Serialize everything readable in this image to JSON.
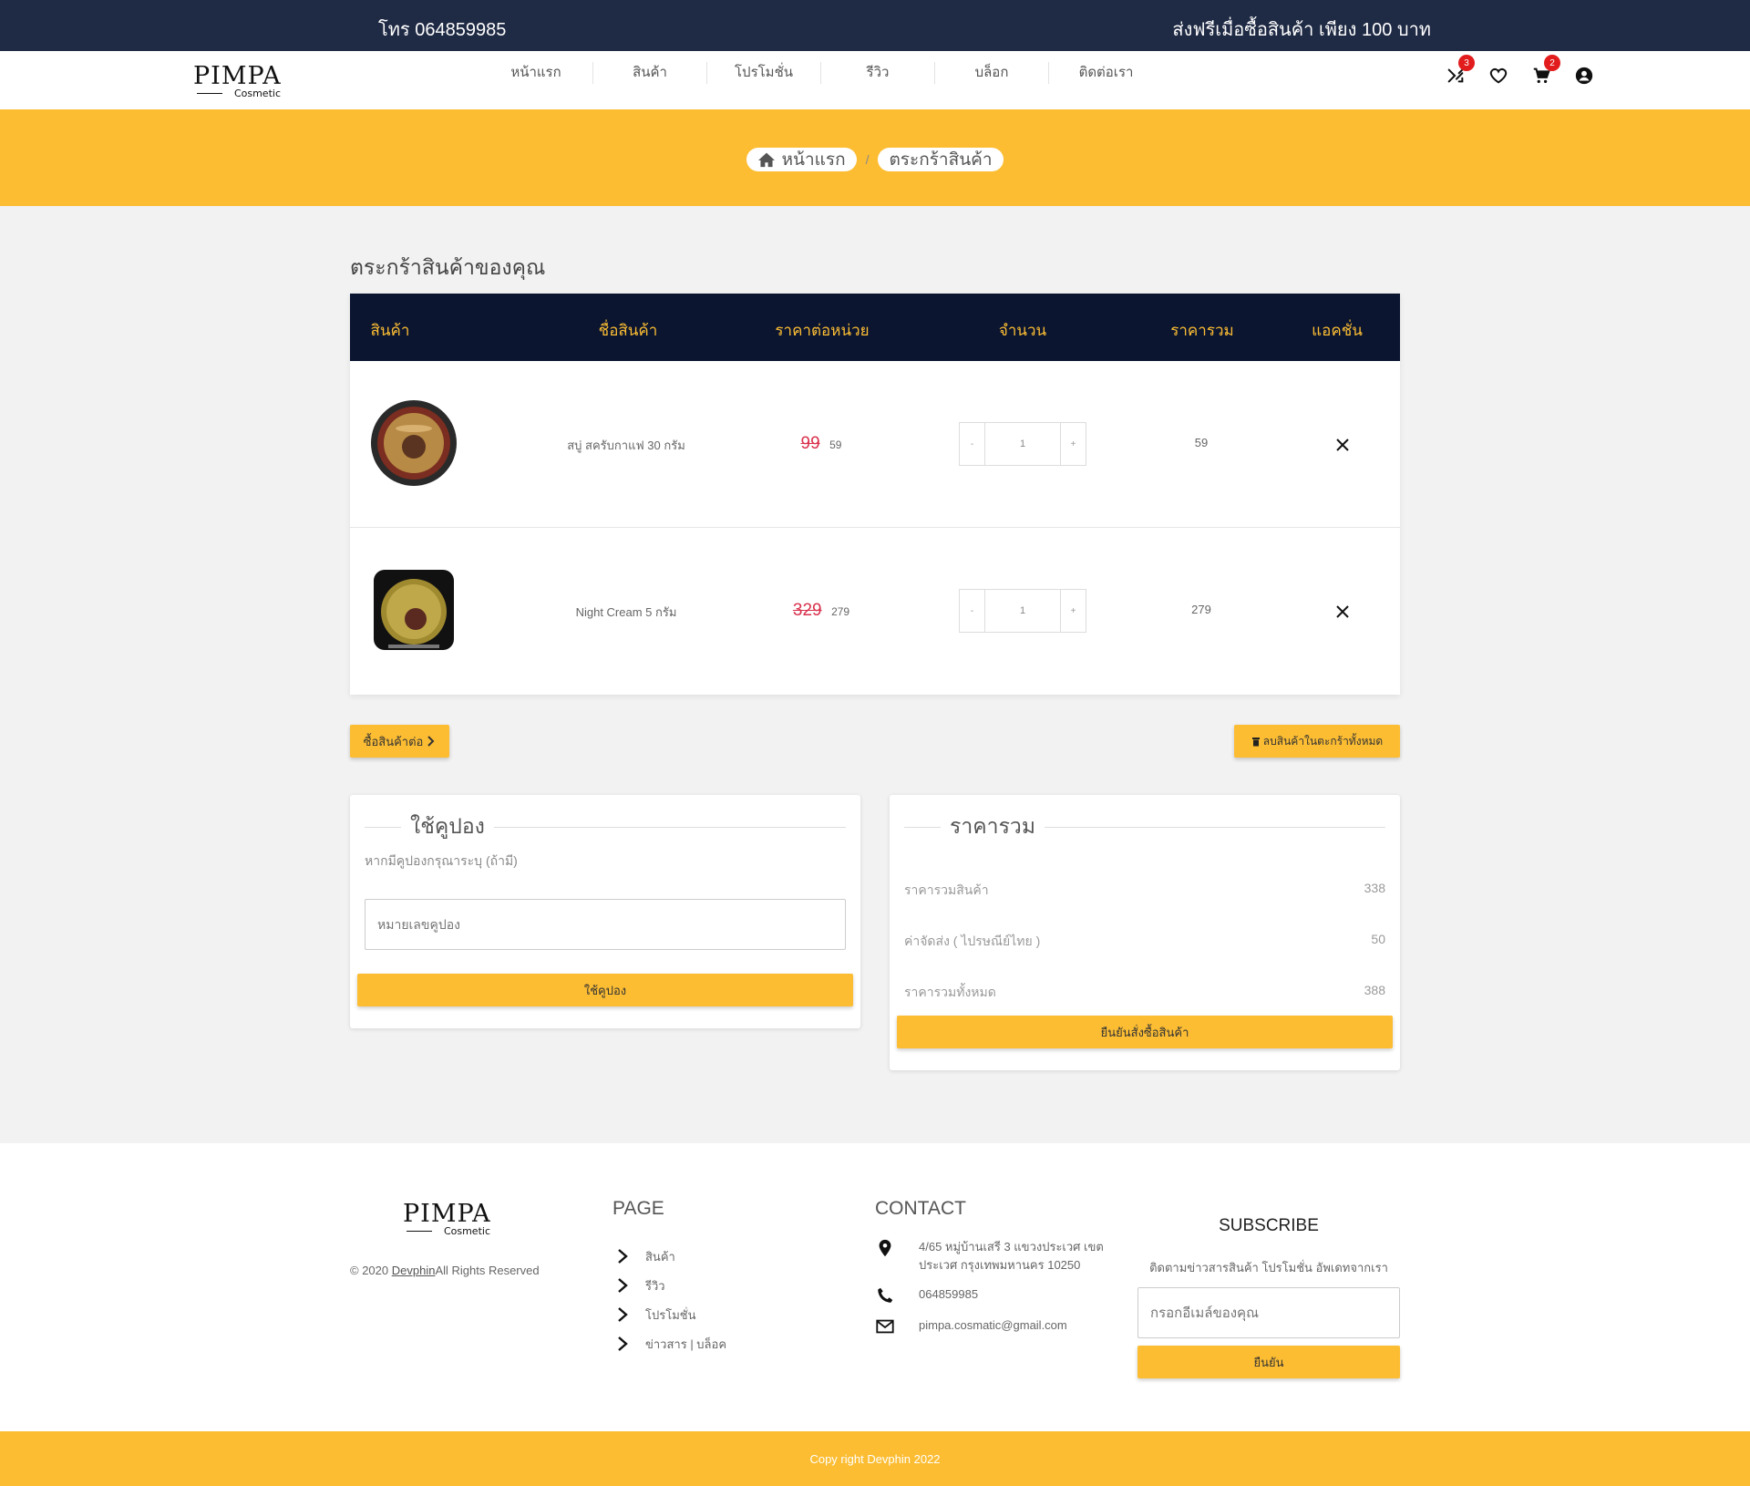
{
  "topbar": {
    "phone": "โทร 064859985",
    "promo": "ส่งฟรีเมื่อซื้อสินค้า เพียง 100 บาท"
  },
  "brand": {
    "name": "PIMPA",
    "sub": "Cosmetic"
  },
  "nav": {
    "links": [
      "หน้าแรก",
      "สินค้า",
      "โปรโมชั่น",
      "รีวิว",
      "บล็อก",
      "ติดต่อเรา"
    ],
    "compare_count": "3",
    "cart_count": "2"
  },
  "breadcrumb": {
    "home": "หน้าแรก",
    "separator": "/",
    "current": "ตระกร้าสินค้า"
  },
  "cart": {
    "title": "ตระกร้าสินค้าของคุณ",
    "headers": [
      "สินค้า",
      "ชื่อสินค้า",
      "ราคาต่อหน่วย",
      "จำนวน",
      "ราคารวม",
      "แอคชั่น"
    ],
    "rows": [
      {
        "name": "สบู่ สครับกาแฟ 30 กรัม",
        "old_price": "99",
        "price": "59",
        "qty": "1",
        "total": "59"
      },
      {
        "name": "Night Cream 5 กรัม",
        "old_price": "329",
        "price": "279",
        "qty": "1",
        "total": "279"
      }
    ],
    "qty_minus": "-",
    "qty_plus": "+",
    "continue_label": "ซื้อสินค้าต่อ",
    "clear_label": "ลบสินค้าในตะกร้าทั้งหมด"
  },
  "coupon": {
    "title": "ใช้คูปอง",
    "hint": "หากมีคูปองกรุณาระบุ (ถ้ามี)",
    "placeholder": "หมายเลขคูปอง",
    "apply_label": "ใช้คูปอง"
  },
  "summary": {
    "title": "ราคารวม",
    "subtotal_label": "ราคารวมสินค้า",
    "subtotal": "338",
    "shipping_label": "ค่าจัดส่ง ( ไปรษณีย์ไทย )",
    "shipping": "50",
    "total_label": "ราคารวมทั้งหมด",
    "total": "388",
    "confirm_label": "ยืนยันสั่งซื้อสินค้า"
  },
  "footer": {
    "copyright_prefix": "© 2020 ",
    "copyright_link": "Devphin",
    "copyright_suffix": "All Rights Reserved",
    "page_title": "PAGE",
    "page_links": [
      "สินค้า",
      "รีวิว",
      "โปรโมชั่น",
      "ข่าวสาร | บล็อค"
    ],
    "contact_title": "CONTACT",
    "address": "4/65 หมู่บ้านเสรี 3 แขวงประเวศ เขตประเวศ กรุงเทพมหานคร 10250",
    "phone": "064859985",
    "email": "pimpa.cosmatic@gmail.com",
    "subscribe_title": "SUBSCRIBE",
    "subscribe_sub": "ติดตามข่าวสารสินค้า โปรโมชั่น อัพเดทจากเรา",
    "subscribe_placeholder": "กรอกอีเมล์ของคุณ",
    "subscribe_label": "ยืนยัน"
  },
  "bottom": {
    "text": "Copy right Devphin 2022"
  },
  "colors": {
    "navy": "#1f2a44",
    "table_header": "#0b1530",
    "accent": "#fcbd33",
    "strike": "#d9314d",
    "badge": "#e21c1c"
  },
  "icons": [
    "compare-icon",
    "heart-icon",
    "cart-icon",
    "account-icon",
    "home-icon",
    "close-icon",
    "chevron-right-icon",
    "trash-icon",
    "location-icon",
    "phone-icon",
    "mail-icon"
  ]
}
